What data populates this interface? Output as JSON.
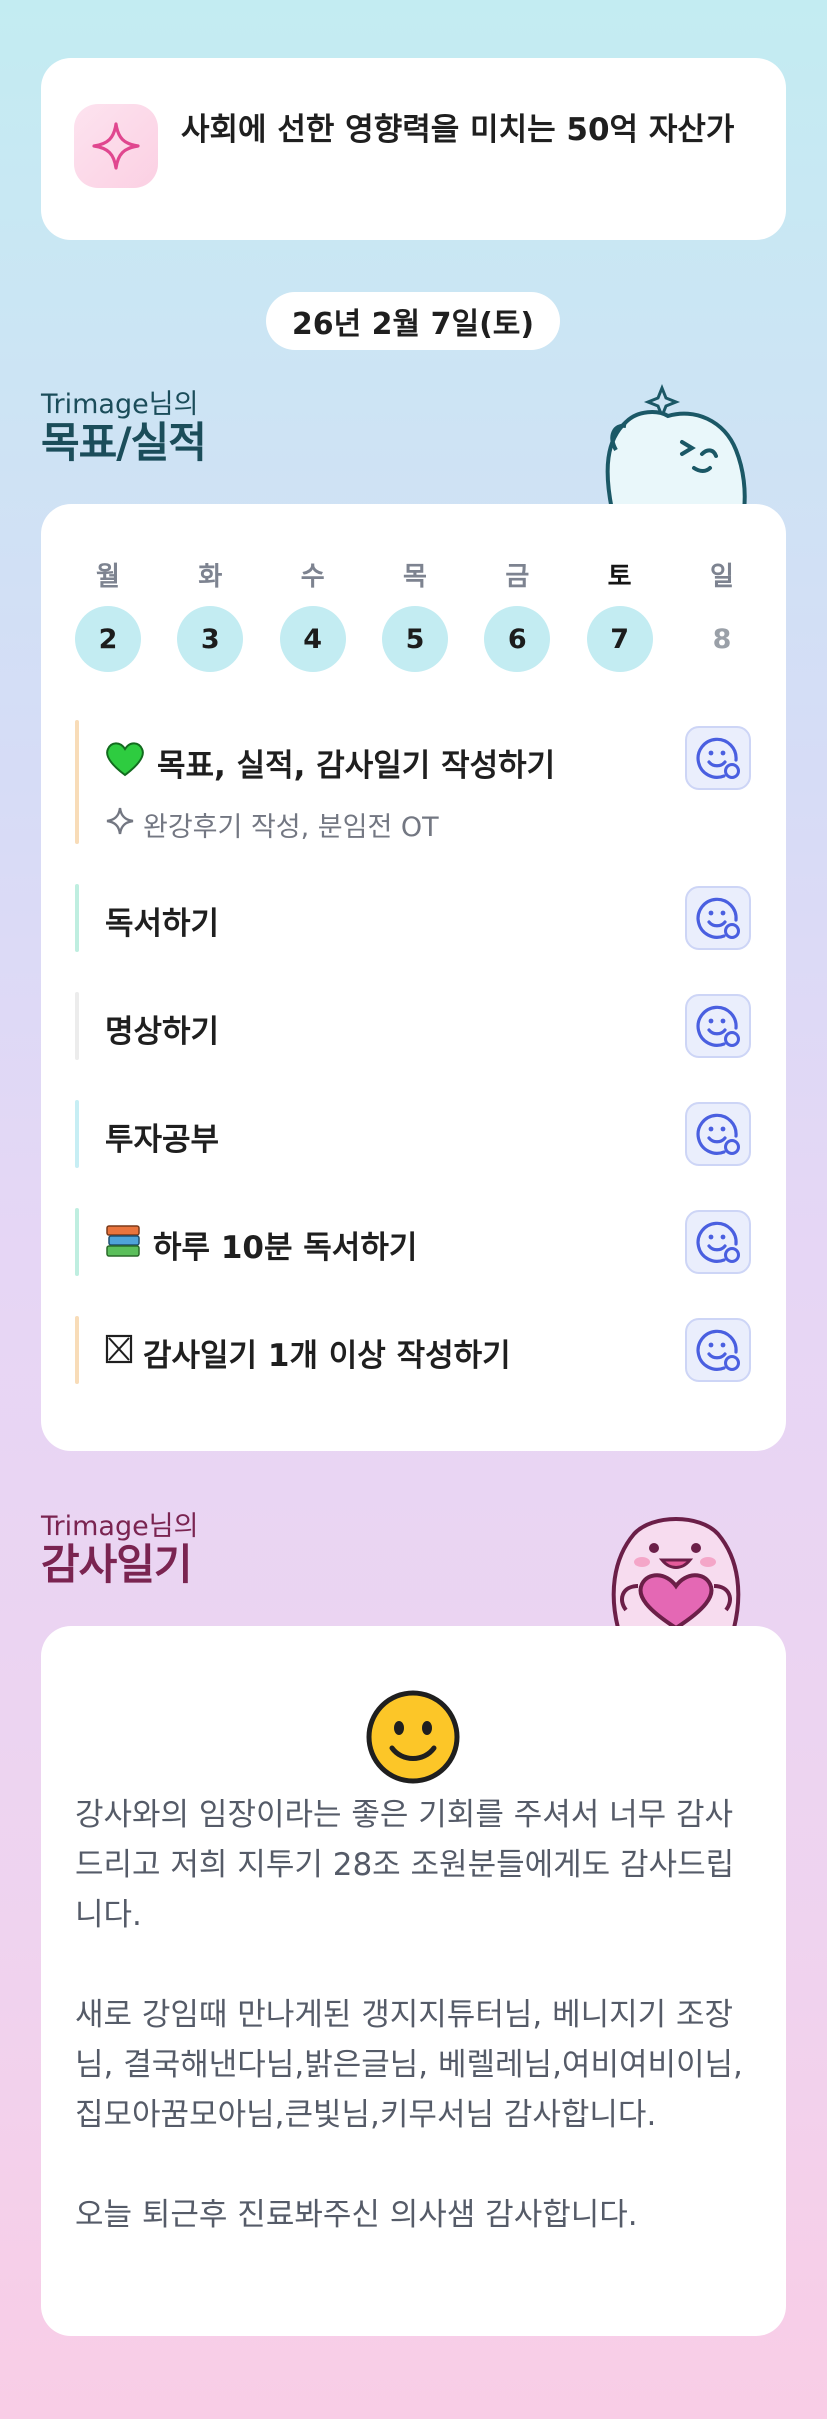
{
  "goal": {
    "text": "사회에 선한 영향력을 미치는 50억 자산가",
    "icon": "sparkle-icon"
  },
  "date": "26년 2월 7일(토)",
  "goals_section": {
    "owner": "Trimage님의",
    "title": "목표/실적"
  },
  "week": [
    {
      "name": "월",
      "num": "2",
      "highlight": true
    },
    {
      "name": "화",
      "num": "3",
      "highlight": true
    },
    {
      "name": "수",
      "num": "4",
      "highlight": true
    },
    {
      "name": "목",
      "num": "5",
      "highlight": true
    },
    {
      "name": "금",
      "num": "6",
      "highlight": true
    },
    {
      "name": "토",
      "num": "7",
      "highlight": true,
      "active": true
    },
    {
      "name": "일",
      "num": "8",
      "highlight": false
    }
  ],
  "tasks": [
    {
      "label": "목표, 실적, 감사일기 작성하기",
      "prefix": "green-heart-icon",
      "sublabel": "완강후기 작성, 분임전 OT",
      "bar_color": "#f8dcb8"
    },
    {
      "label": "독서하기",
      "bar_color": "#bfeee0"
    },
    {
      "label": "명상하기",
      "bar_color": "#ececec"
    },
    {
      "label": "투자공부",
      "bar_color": "#c7eef4"
    },
    {
      "label": "하루 10분 독서하기",
      "prefix": "books-icon",
      "bar_color": "#bfeee0"
    },
    {
      "label": "감사일기 1개 이상 작성하기",
      "prefix": "ballot-x-icon",
      "bar_color": "#f8dcb8"
    }
  ],
  "diary_section": {
    "owner": "Trimage님의",
    "title": "감사일기"
  },
  "diary": {
    "mood_icon": "smiley-face-icon",
    "paragraphs": [
      "강사와의 임장이라는 좋은 기회를 주셔서 너무 감사드리고 저희 지투기 28조 조원분들에게도 감사드립니다.",
      "새로 강임때 만나게된 갱지지튜터님, 베니지기 조장님, 결국해낸다님,밝은글님, 베렐레님,여비여비이님,집모아꿈모아님,큰빛님,키무서님 감사합니다.",
      "오늘 퇴근후 진료봐주신 의사샘 감사합니다."
    ]
  },
  "colors": {
    "accent_teal": "#c3ecf2",
    "title_teal": "#1b4d5a",
    "title_plum": "#7a2451",
    "emoji_button_blue": "#4a5fe0"
  }
}
